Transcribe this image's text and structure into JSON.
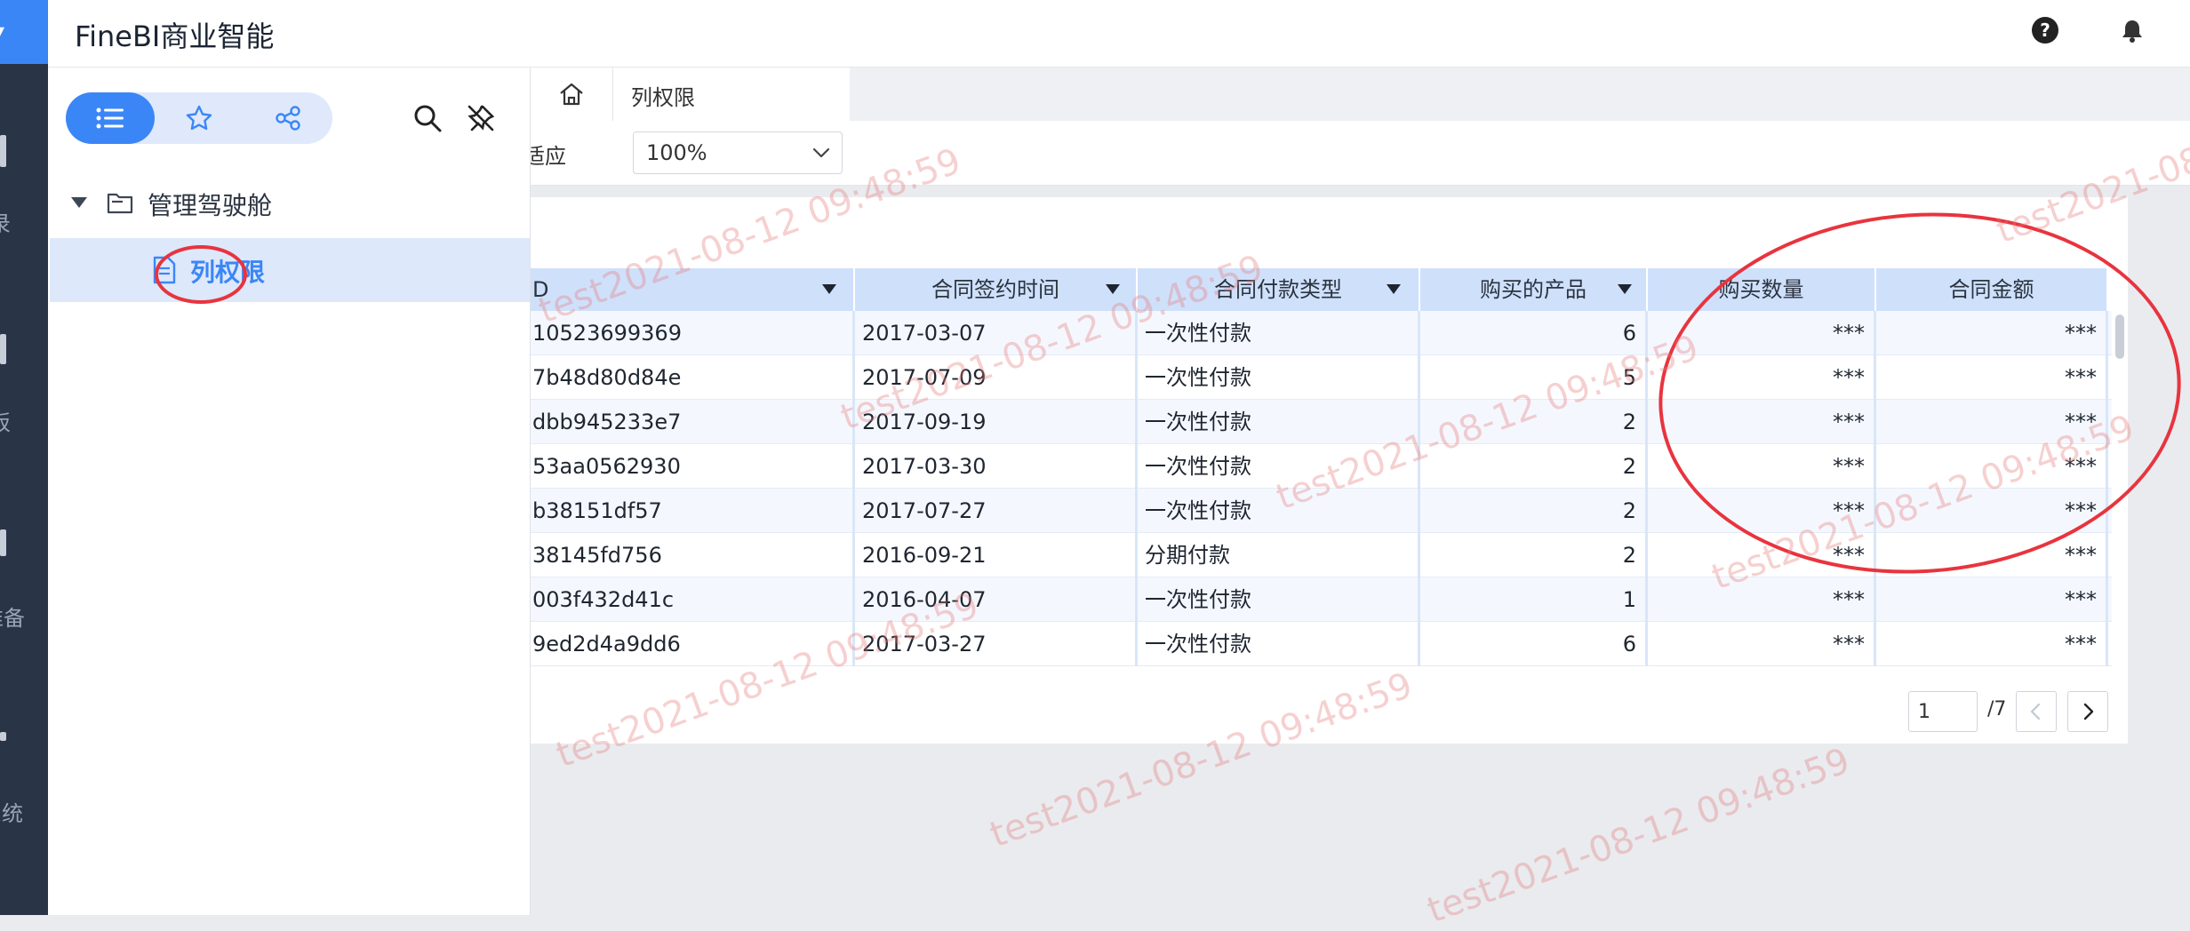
{
  "app": {
    "title": "FineBI商业智能"
  },
  "nav_strip": {
    "top_fragment": "▾",
    "items": [
      "录",
      "板",
      "准备",
      "系统"
    ]
  },
  "sidebar": {
    "tree_root": "管理驾驶舱",
    "tree_item": "列权限"
  },
  "tabs": {
    "current": "列权限"
  },
  "toolbar": {
    "fit_fragment": "适应",
    "zoom": "100%"
  },
  "table": {
    "columns": [
      {
        "label": "D"
      },
      {
        "label": "合同签约时间"
      },
      {
        "label": "合同付款类型"
      },
      {
        "label": "购买的产品"
      },
      {
        "label": "购买数量"
      },
      {
        "label": "合同金额"
      }
    ],
    "rows": [
      [
        "10523699369",
        "2017-03-07",
        "一次性付款",
        "6",
        "***",
        "***"
      ],
      [
        "7b48d80d84e",
        "2017-07-09",
        "一次性付款",
        "5",
        "***",
        "***"
      ],
      [
        "dbb945233e7",
        "2017-09-19",
        "一次性付款",
        "2",
        "***",
        "***"
      ],
      [
        "53aa0562930",
        "2017-03-30",
        "一次性付款",
        "2",
        "***",
        "***"
      ],
      [
        "b38151df57",
        "2017-07-27",
        "一次性付款",
        "2",
        "***",
        "***"
      ],
      [
        "38145fd756",
        "2016-09-21",
        "分期付款",
        "2",
        "***",
        "***"
      ],
      [
        "003f432d41c",
        "2016-04-07",
        "一次性付款",
        "1",
        "***",
        "***"
      ],
      [
        "9ed2d4a9dd6",
        "2017-03-27",
        "一次性付款",
        "6",
        "***",
        "***"
      ]
    ]
  },
  "pager": {
    "current": "1",
    "total": "/7"
  },
  "watermark_text": "test2021-08-12 09:48:59",
  "watermark_partial": "test2021-08-12 09:48:59",
  "colors": {
    "accent": "#3b86f7",
    "nav_dark": "#2a3447",
    "annotation": "#e8343e",
    "header_row": "#cfe0fb"
  }
}
